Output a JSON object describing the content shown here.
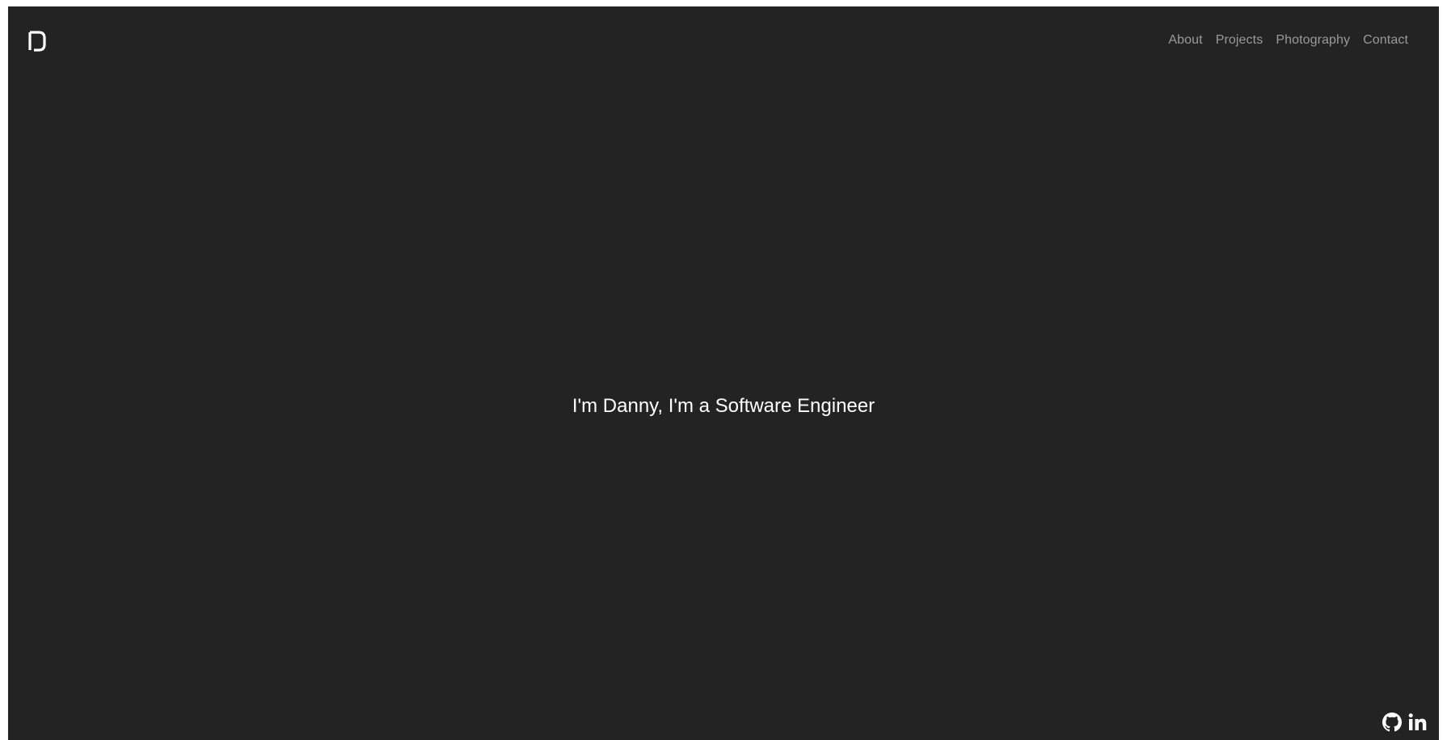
{
  "brand": {
    "logo_icon": "d-logo-icon"
  },
  "nav": {
    "items": [
      {
        "label": "About"
      },
      {
        "label": "Projects"
      },
      {
        "label": "Photography"
      },
      {
        "label": "Contact"
      }
    ]
  },
  "hero": {
    "headline": "I'm Danny, I'm a Software Engineer"
  },
  "social": {
    "github_icon": "github-icon",
    "linkedin_icon": "linkedin-icon"
  },
  "colors": {
    "background": "#232323",
    "nav_text": "#9a9a9a",
    "headline_text": "#ffffff"
  }
}
